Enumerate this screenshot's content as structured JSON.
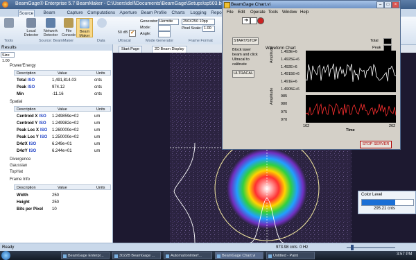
{
  "app": {
    "title": "BeamGage® Enterprise 5.7 BeamMaker - C:\\Users\\dell\\Documents\\BeamGage\\Setups\\sp503.bgSetup - Instance1",
    "menu_tabs": [
      "Source",
      "Beam Display",
      "Capture",
      "Computations",
      "Aperture",
      "Beam Profile",
      "Charts",
      "Logging",
      "Report"
    ]
  },
  "ribbon": {
    "buttons": [
      {
        "label": "Local Detector",
        "icon": "detector-icon"
      },
      {
        "label": "Network Detector",
        "icon": "network-icon"
      },
      {
        "label": "File Console",
        "icon": "file-icon"
      },
      {
        "label": "Beam Maker",
        "icon": "beam-maker-icon"
      }
    ],
    "ultracal_label": "Ultracal",
    "db_label": "50 dB",
    "generator_label": "Generator:",
    "generator_value": "Hermite",
    "mode_label": "Mode:",
    "angle_label": "Angle:",
    "resolution_value": "250X250 10pp",
    "pixel_scale_label": "Pixel Scale:",
    "pixel_scale_value": "1.00",
    "groups": [
      "Tools",
      "Source: BeamMaker",
      "Data",
      "Ultracal",
      "Mode Generator",
      "Frame Format"
    ]
  },
  "results": {
    "title": "Results",
    "size_value": "Size 1.00",
    "columns": [
      "Description",
      "Value",
      "Units"
    ],
    "power_energy": {
      "title": "Power/Energy",
      "rows": [
        {
          "desc": "Total",
          "iso": "ISO",
          "value": "1,491,814.03",
          "units": "cnts"
        },
        {
          "desc": "Peak",
          "iso": "ISO",
          "value": "974.12",
          "units": "cnts"
        },
        {
          "desc": "Min",
          "iso": "",
          "value": "-11.16",
          "units": "cnts"
        }
      ]
    },
    "spatial": {
      "title": "Spatial",
      "rows": [
        {
          "desc": "Centroid X",
          "iso": "ISO",
          "value": "1.249859e+02",
          "units": "um"
        },
        {
          "desc": "Centroid Y",
          "iso": "ISO",
          "value": "1.249982e+02",
          "units": "um"
        },
        {
          "desc": "Peak Loc X",
          "iso": "ISO",
          "value": "1.260000e+02",
          "units": "um"
        },
        {
          "desc": "Peak Loc Y",
          "iso": "ISO",
          "value": "1.250000e+02",
          "units": "um"
        },
        {
          "desc": "D4σX",
          "iso": "ISO",
          "value": "6.249e+01",
          "units": "um"
        },
        {
          "desc": "D4σY",
          "iso": "ISO",
          "value": "6.244e+01",
          "units": "um"
        }
      ]
    },
    "collapsed": [
      "Divergence",
      "Gaussian",
      "TopHat"
    ],
    "frame_info": {
      "title": "Frame Info",
      "rows": [
        {
          "desc": "Width",
          "value": "250",
          "units": ""
        },
        {
          "desc": "Height",
          "value": "250",
          "units": ""
        },
        {
          "desc": "Bits per Pixel",
          "value": "10",
          "units": ""
        }
      ]
    }
  },
  "doc_tabs": [
    "Start Page",
    "2D Beam Display"
  ],
  "status": {
    "ready": "Ready",
    "readout": "973.98 cnts",
    "hz": "0 Hz"
  },
  "color_level": {
    "title": "Color Level",
    "value": "295.21 cnts",
    "level_fraction": 0.65,
    "bar_color": "#1a6fd6"
  },
  "labview": {
    "title": "BeamGage Chart.vi",
    "menu": [
      "File",
      "Edit",
      "Operate",
      "Tools",
      "Window",
      "Help"
    ],
    "start_stop": "START/STOP",
    "instructions": "Block laser beam and click Ultracal to calibrate",
    "ultracal_button": "ULTRACAL",
    "chart_title": "Waveform Chart",
    "legend": [
      "Total",
      "Peak"
    ],
    "y_label": "Amplitude",
    "x_label": "Time",
    "x_range": [
      "162",
      "262"
    ],
    "total_ticks": [
      "1.493E+6",
      "1.4925E+6",
      "1.492E+6",
      "1.4915E+6",
      "1.491E+6",
      "1.4905E+6"
    ],
    "peak_ticks": [
      "985",
      "980",
      "975",
      "970"
    ],
    "stop_server": "STOP SERVER",
    "series_colors": {
      "total": "#ffffff",
      "peak": "#ff3030"
    }
  },
  "taskbar": {
    "tasks": [
      "BeamGage Enterpr...",
      "3022B BeamGage ...",
      "AutomationInterf...",
      "BeamGage Chart.vi",
      "Untitled - Paint"
    ],
    "clock": "3:57 PM"
  }
}
